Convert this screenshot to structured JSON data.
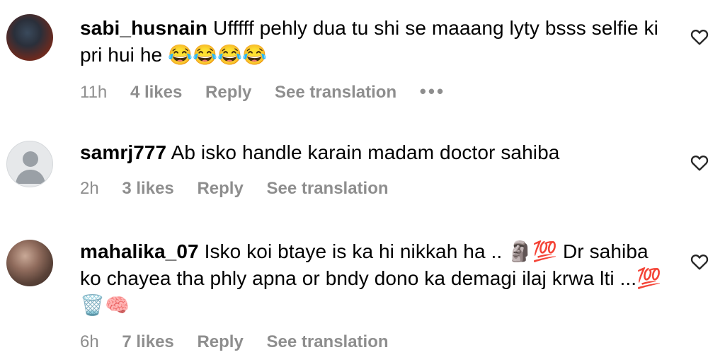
{
  "comments": [
    {
      "username": "sabi_husnain",
      "text": "Ufffff pehly dua tu shi se maaang lyty bsss selfie ki pri hui he 😂😂😂😂",
      "time": "11h",
      "likes": "4 likes",
      "reply": "Reply",
      "translate": "See translation",
      "more": "•••",
      "avatar_icon": "profile-photo",
      "heart_icon": "heart-outline-icon"
    },
    {
      "username": "samrj777",
      "text": "Ab isko handle karain madam doctor sahiba",
      "time": "2h",
      "likes": "3 likes",
      "reply": "Reply",
      "translate": "See translation",
      "avatar_icon": "default-avatar-icon",
      "heart_icon": "heart-outline-icon"
    },
    {
      "username": "mahalika_07",
      "text": "Isko koi btaye is ka hi nikkah ha .. 🗿💯 Dr sahiba ko chayea tha phly apna or bndy dono ka demagi ilaj krwa lti ...💯🗑️🧠",
      "time": "6h",
      "likes": "7 likes",
      "reply": "Reply",
      "translate": "See translation",
      "avatar_icon": "profile-photo",
      "heart_icon": "heart-outline-icon"
    }
  ],
  "colors": {
    "meta_gray": "#8e8e8e",
    "text": "#000000",
    "background": "#ffffff"
  }
}
